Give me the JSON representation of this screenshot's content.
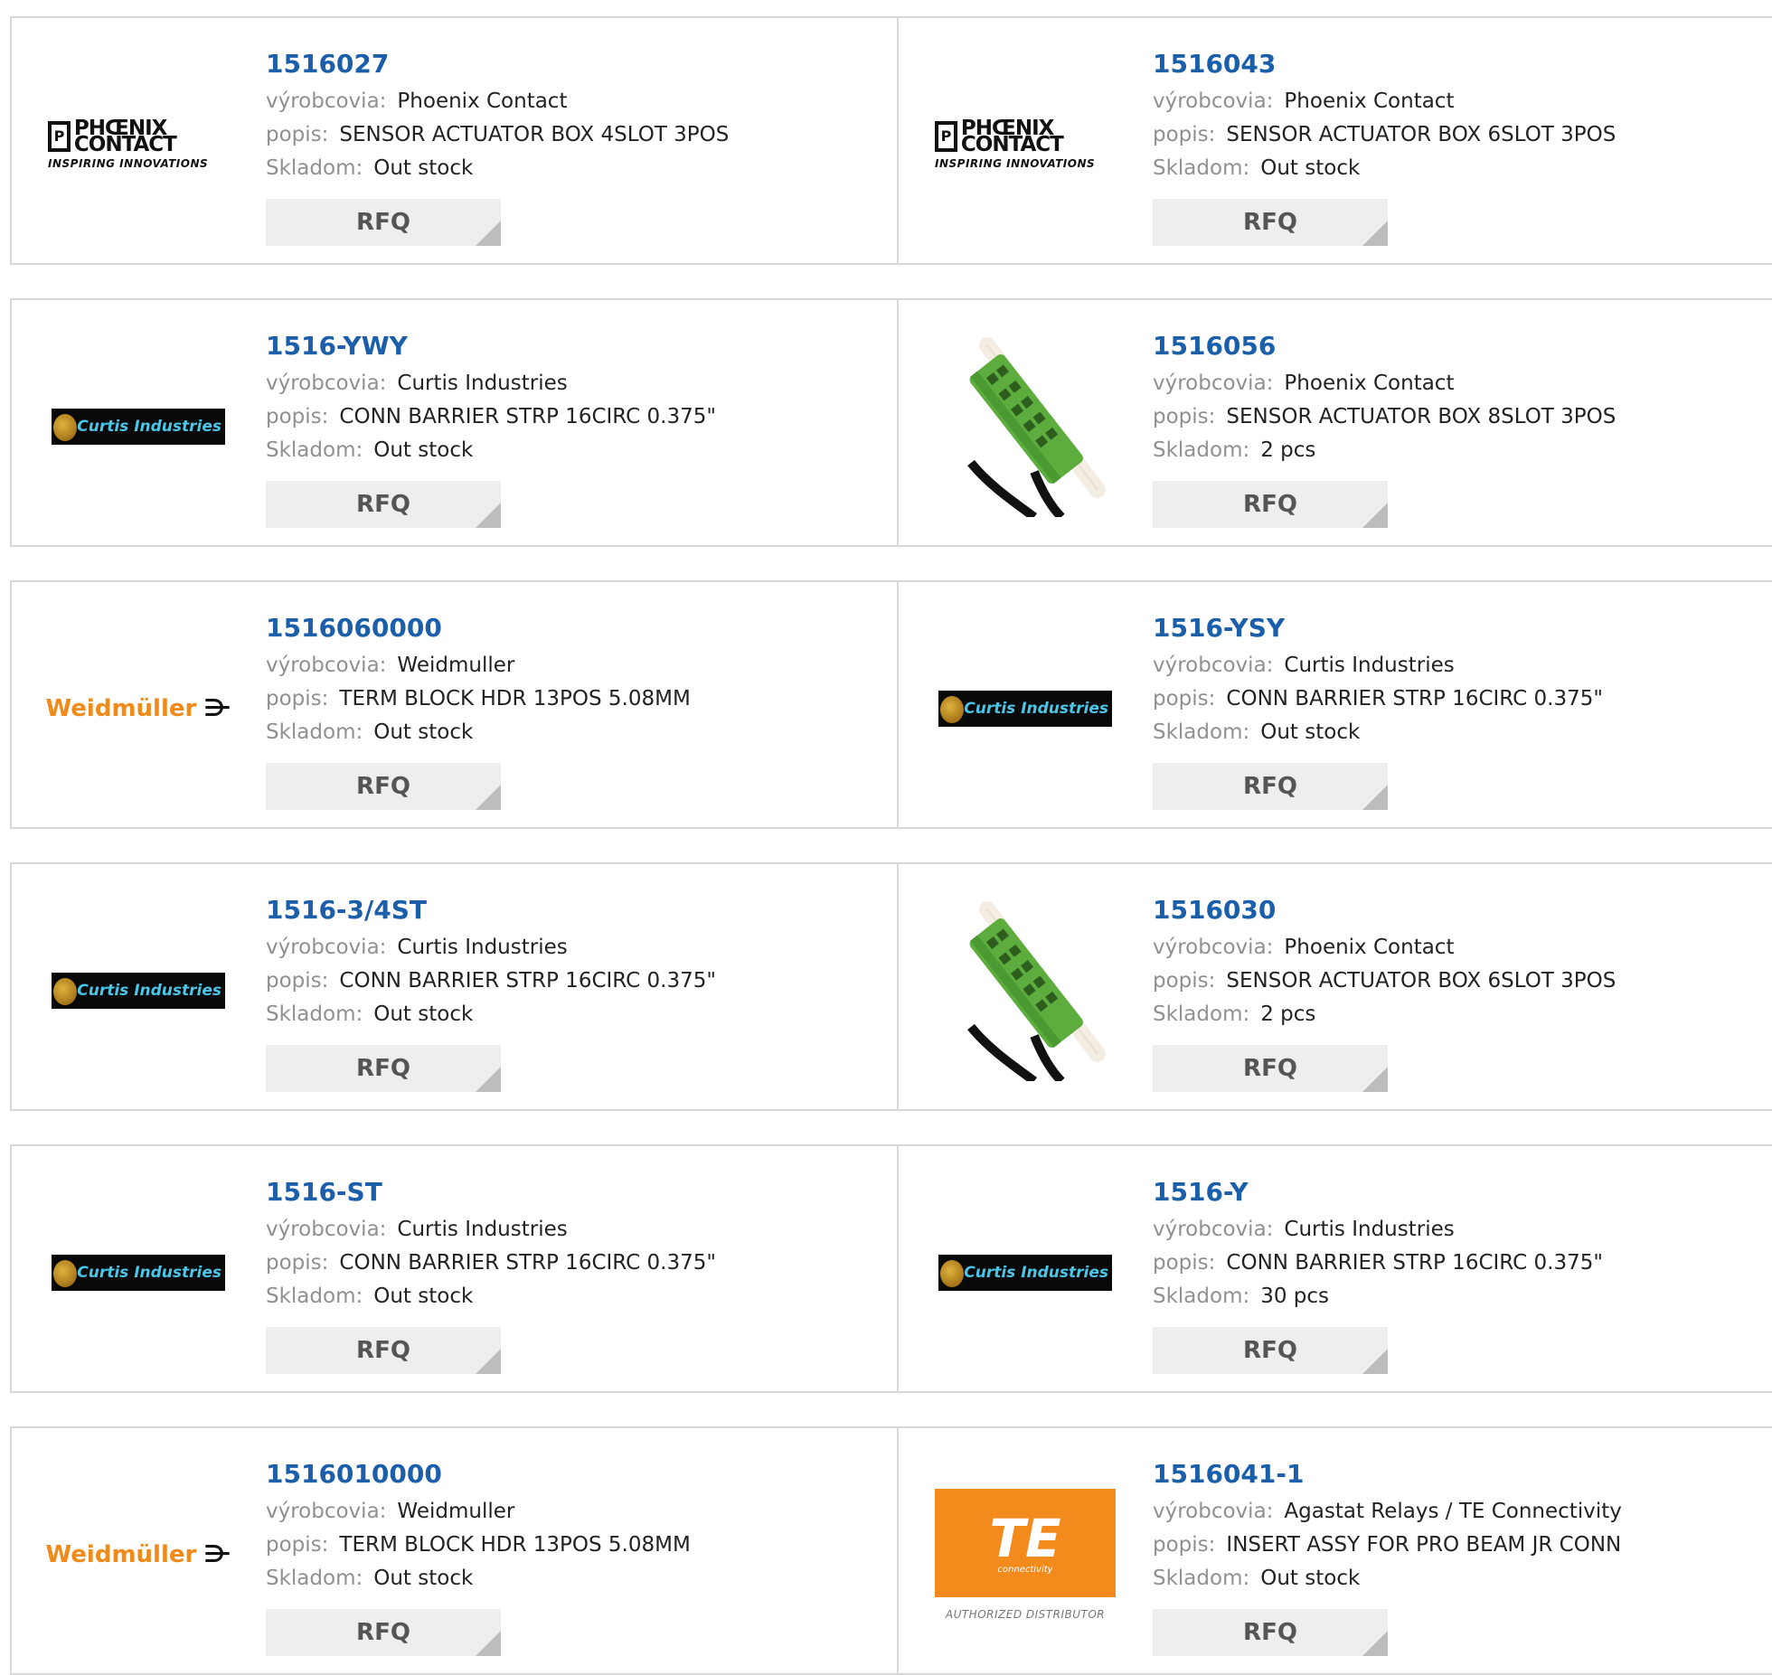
{
  "labels": {
    "manufacturer": "výrobcovia:",
    "description": "popis:",
    "stock": "Skladom:",
    "rfq": "RFQ"
  },
  "logos": {
    "phoenix_name": "PHŒNIX CONTACT",
    "phoenix_tag": "INSPIRING INNOVATIONS",
    "curtis_name": "Curtis Industries",
    "weidmuller_name": "Weidmüller",
    "te_mark": "TE",
    "te_sub": "connectivity",
    "te_auth": "AUTHORIZED DISTRIBUTOR"
  },
  "items": [
    {
      "part": "1516027",
      "logo": "phoenix",
      "manufacturer": "Phoenix Contact",
      "description": "SENSOR ACTUATOR BOX 4SLOT 3POS",
      "stock": "Out stock"
    },
    {
      "part": "1516043",
      "logo": "phoenix",
      "manufacturer": "Phoenix Contact",
      "description": "SENSOR ACTUATOR BOX 6SLOT 3POS",
      "stock": "Out stock"
    },
    {
      "part": "1516-YWY",
      "logo": "curtis",
      "manufacturer": "Curtis Industries",
      "description": "CONN BARRIER STRP 16CIRC 0.375\"",
      "stock": "Out stock"
    },
    {
      "part": "1516056",
      "logo": "product",
      "manufacturer": "Phoenix Contact",
      "description": "SENSOR ACTUATOR BOX 8SLOT 3POS",
      "stock": "2 pcs"
    },
    {
      "part": "1516060000",
      "logo": "weidmuller",
      "manufacturer": "Weidmuller",
      "description": "TERM BLOCK HDR 13POS 5.08MM",
      "stock": "Out stock"
    },
    {
      "part": "1516-YSY",
      "logo": "curtis",
      "manufacturer": "Curtis Industries",
      "description": "CONN BARRIER STRP 16CIRC 0.375\"",
      "stock": "Out stock"
    },
    {
      "part": "1516-3/4ST",
      "logo": "curtis",
      "manufacturer": "Curtis Industries",
      "description": "CONN BARRIER STRP 16CIRC 0.375\"",
      "stock": "Out stock"
    },
    {
      "part": "1516030",
      "logo": "product",
      "manufacturer": "Phoenix Contact",
      "description": "SENSOR ACTUATOR BOX 6SLOT 3POS",
      "stock": "2 pcs"
    },
    {
      "part": "1516-ST",
      "logo": "curtis",
      "manufacturer": "Curtis Industries",
      "description": "CONN BARRIER STRP 16CIRC 0.375\"",
      "stock": "Out stock"
    },
    {
      "part": "1516-Y",
      "logo": "curtis",
      "manufacturer": "Curtis Industries",
      "description": "CONN BARRIER STRP 16CIRC 0.375\"",
      "stock": "30 pcs"
    },
    {
      "part": "1516010000",
      "logo": "weidmuller",
      "manufacturer": "Weidmuller",
      "description": "TERM BLOCK HDR 13POS 5.08MM",
      "stock": "Out stock"
    },
    {
      "part": "1516041-1",
      "logo": "te",
      "manufacturer": "Agastat Relays / TE Connectivity",
      "description": "INSERT ASSY FOR PRO BEAM JR CONN",
      "stock": "Out stock"
    }
  ]
}
